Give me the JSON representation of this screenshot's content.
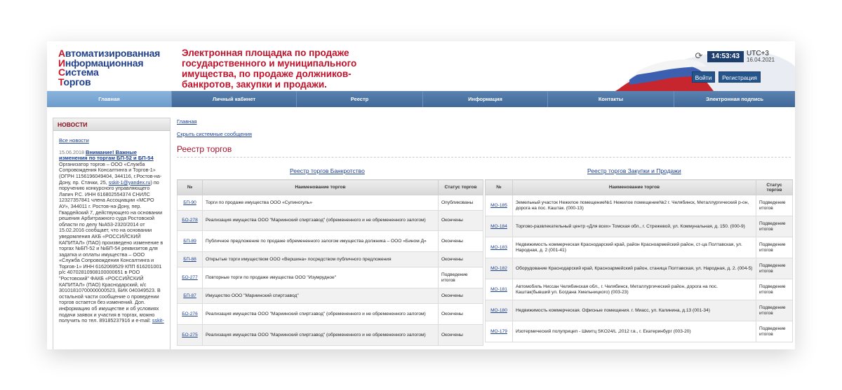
{
  "logo": {
    "line1_first": "А",
    "line1_rest": "втоматизированная",
    "line2_first": "И",
    "line2_rest": "нформационная",
    "line3_first": "С",
    "line3_rest": "истема",
    "line4_first": "Т",
    "line4_rest": "оргов"
  },
  "headline": "Электронная площадка по продаже государственного и муниципального имущества, по продаже должников-банкротов, закупки и продажи.",
  "clock": "14:53:43",
  "utc": "UTC+3",
  "date": "16.04.2021",
  "buttons": {
    "login": "Войти",
    "register": "Регистрация"
  },
  "nav": [
    {
      "label": "Главная",
      "active": true
    },
    {
      "label": "Личный кабинет"
    },
    {
      "label": "Реестр"
    },
    {
      "label": "Информация"
    },
    {
      "label": "Контакты"
    },
    {
      "label": "Электронная подпись"
    }
  ],
  "news": {
    "heading": "НОВОСТИ",
    "all": "Все новости",
    "date": "15.06.2018",
    "title": "Внимание! Важные изменения по торгам БП-52 и БП-54",
    "body_1": "Организатор торгов – ООО «Служба Сопровождения Консалтинга и Торгов-1» (ОГРН 1156196049404, 344116, г.Ростов-на-Дону, пр. Стачки, 25,",
    "email": "sskit-1@yandex.ru",
    "body_2": ") по поручению конкурсного управляющего Лапич Р.С. ИНН 616802554374 СНИЛС 12327357841 члена Ассоциации «МСРО АУ», 344011 г. Ростов-на-Дону, пер. Гвардейский 7, действующего на основании решения Арбитражного суда Ростовской области по делу №А53-2320/2014 от 15.02.2016 сообщает, что на основании уведомления АКБ «РОССИЙСКИЙ КАПИТАЛ» (ПАО) произведено изменение в торгах №БП-52 и №БП-54 реквизитов для задатка и оплаты имущества – ООО «Служба Сопровождения Консалтинга и Торгов-1» ИНН 6162069529 КПП 616201001 р/с 40702810908100000651 в РОО \"Ростовский\" ФАКБ «РОССИЙСКИЙ КАПИТАЛ» (ПАО) Краснодарский, к/с 30101810700000000523, БИК 040349523. В остальной части сообщение о проведении торгов остается без изменений. Доп. информацию об имуществе и об условиях подачи заявок и участия в торгах, можно получить по тел. 89185237916 и e-mail:",
    "email2": "sskit-"
  },
  "breadcrumb": "Главная",
  "hide_messages": "Скрыть системные сообщения",
  "page_title": "Реестр торгов",
  "left_registry": {
    "title": "Реестр торгов Банкротство",
    "headers": {
      "num": "№",
      "name": "Наименование торгов",
      "status": "Статус торгов"
    },
    "rows": [
      {
        "num": "БП-90",
        "name": "Торги по продаже имущества ООО «Сулиногуль»",
        "status": "Опубликованы"
      },
      {
        "num": "БО-278",
        "name": "Реализация имущества ООО \"Мариинский спиртзавод\" (обремененного и не обремененного залогом)",
        "status": "Окончены"
      },
      {
        "num": "БП-89",
        "name": "Публичное предложение по продаже обремененного залогом имущества должника – ООО «Бином Д»",
        "status": "Окончены"
      },
      {
        "num": "БП-88",
        "name": "Открытые торги имуществом ООО «Вершина» посредством публичного предложения",
        "status": "Окончены"
      },
      {
        "num": "БО-277",
        "name": "Повторные торги по продаже имущества ООО \"Изумрудное\"",
        "status": "Подведение итогов"
      },
      {
        "num": "БП-87",
        "name": "Имущество ООО \"Мариинский спиртзавод\"",
        "status": "Окончены"
      },
      {
        "num": "БО-276",
        "name": "Реализация имущества ООО \"Мариинский спиртзавод\" (обремененного и не обремененного залогом)",
        "status": "Окончены"
      },
      {
        "num": "БО-275",
        "name": "Реализация имущества ООО \"Мариинский спиртзавод\" (обремененного и не обремененного залогом)",
        "status": "Окончены"
      }
    ]
  },
  "right_registry": {
    "title": "Реестр торгов Закупки и Продажи",
    "headers": {
      "num": "№",
      "name": "Наименование торгов",
      "status": "Статус торгов"
    },
    "rows": [
      {
        "num": "МО-185",
        "name": "Земельный участок Нежилое помещение№1 Нежилое помещение№2 г. Челябинск, Металлургический р-он, дорога на пос. Каштак. (000-13)",
        "status": "Подведение итогов"
      },
      {
        "num": "МО-184",
        "name": "Торгово-развлекательный центр «Для всех» Томская обл., г. Стрежевой, ул. Коммунальная, д. 150. (000-9)",
        "status": "Подведение итогов"
      },
      {
        "num": "МО-183",
        "name": "Недвижимость коммерческая Краснодарский край, район Красноармейский район, ст-ца Полтавская, ул. Народная, д. 2 (001-41)",
        "status": "Подведение итогов"
      },
      {
        "num": "МО-182",
        "name": "Оборудование Краснодарский край, Красноармейский район, станица Полтавская, ул. Народная, д. 2. (004-5)",
        "status": "Подведение итогов"
      },
      {
        "num": "МО-181",
        "name": "Автомобиль Ниссан Челябинская обл., г. Челябинск, Металлургический район, дорога на пос. Каштак(бывший ул. Богдана Хмельницкого) (003-23)",
        "status": "Подведение итогов"
      },
      {
        "num": "МО-180",
        "name": "Недвижимость коммерческая. Офисные помещения. г. Миасс, ул. Калинина, д.13 (001-34)",
        "status": "Подведение итогов"
      },
      {
        "num": "МО-179",
        "name": "Изотермический полуприцеп - Шмитц SKO24/L ,2012 г.в., г. Екатеринбург (003-20)",
        "status": "Подведение итогов"
      }
    ]
  },
  "colors": {
    "nav": "#3f6898",
    "accent_red": "#c0102a",
    "link": "#1b3f8f"
  }
}
